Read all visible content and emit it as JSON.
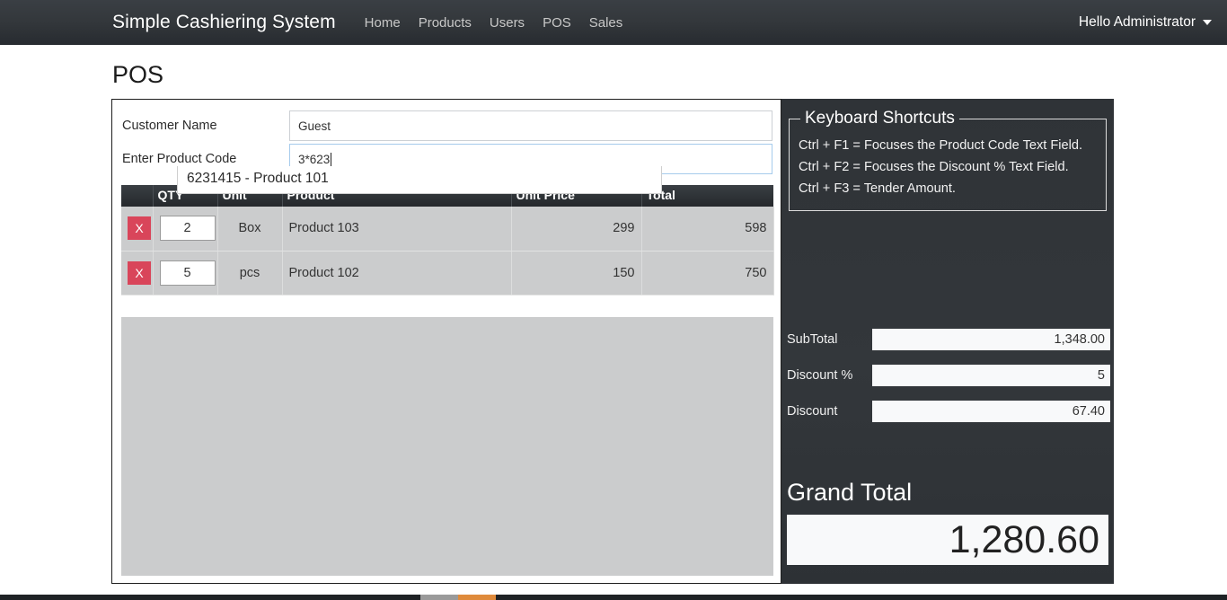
{
  "navbar": {
    "brand": "Simple Cashiering System",
    "links": [
      {
        "label": "Home"
      },
      {
        "label": "Products"
      },
      {
        "label": "Users"
      },
      {
        "label": "POS"
      },
      {
        "label": "Sales"
      }
    ],
    "user_menu": "Hello Administrator",
    "caret_icon": "chevron-down-icon"
  },
  "page": {
    "title": "POS"
  },
  "form": {
    "customer_label": "Customer Name",
    "customer_value": "Guest",
    "customer_placeholder": "Customer Name",
    "product_code_label": "Enter Product Code",
    "product_code_value": "3*623",
    "product_code_placeholder": "Enter Product Code"
  },
  "autocomplete": {
    "items": [
      {
        "label": "6231415 - Product 101"
      }
    ]
  },
  "cart": {
    "columns": [
      "",
      "QTY",
      "Unit",
      "Product",
      "Unit Price",
      "Total"
    ],
    "rows": [
      {
        "delete_label": "X",
        "qty": "2",
        "unit": "Box",
        "product": "Product 103",
        "unit_price": "299",
        "total": "598"
      },
      {
        "delete_label": "X",
        "qty": "5",
        "unit": "pcs",
        "product": "Product 102",
        "unit_price": "150",
        "total": "750"
      }
    ]
  },
  "shortcuts": {
    "legend": "Keyboard Shortcuts",
    "lines": [
      "Ctrl + F1 = Focuses the Product Code Text Field.",
      "Ctrl + F2 = Focuses the Discount % Text Field.",
      "Ctrl + F3 = Tender Amount."
    ]
  },
  "totals": {
    "subtotal_label": "SubTotal",
    "subtotal_value": "1,348.00",
    "discount_pct_label": "Discount %",
    "discount_pct_value": "5",
    "discount_label": "Discount",
    "discount_value": "67.40",
    "grand_total_label": "Grand Total",
    "grand_total_value": "1,280.60"
  },
  "colors": {
    "navbar_dark": "#2f3337",
    "panel_dark": "#33373b",
    "delete_red": "#d9455a",
    "table_row_gray": "#cbcccd",
    "focus_blue": "#a6cbec",
    "footer_accent": "#df8a3b"
  }
}
